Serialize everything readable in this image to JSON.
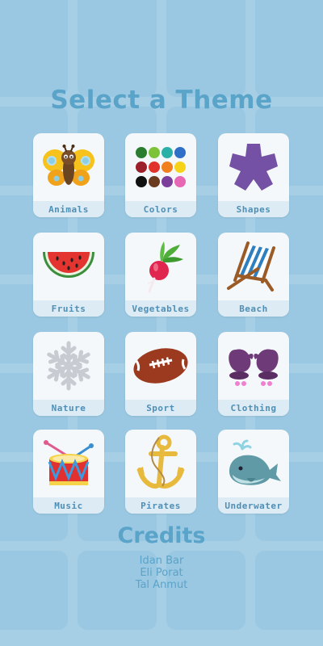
{
  "screen": {
    "title": "Select a Theme",
    "background_color": "#a6cfe6",
    "accent_color": "#5aa3c9"
  },
  "themes": [
    {
      "label": "Animals",
      "icon": "butterfly-icon"
    },
    {
      "label": "Colors",
      "icon": "color-dots-icon"
    },
    {
      "label": "Shapes",
      "icon": "star-shape-icon"
    },
    {
      "label": "Fruits",
      "icon": "watermelon-icon"
    },
    {
      "label": "Vegetables",
      "icon": "radish-icon"
    },
    {
      "label": "Beach",
      "icon": "beach-chair-icon"
    },
    {
      "label": "Nature",
      "icon": "snowflake-icon"
    },
    {
      "label": "Sport",
      "icon": "football-icon"
    },
    {
      "label": "Clothing",
      "icon": "mittens-icon"
    },
    {
      "label": "Music",
      "icon": "drum-icon"
    },
    {
      "label": "Pirates",
      "icon": "anchor-icon"
    },
    {
      "label": "Underwater",
      "icon": "whale-icon"
    }
  ],
  "credits": {
    "title": "Credits",
    "names": [
      "Idan Bar",
      "Eli Porat",
      "Tal Anmut"
    ]
  }
}
